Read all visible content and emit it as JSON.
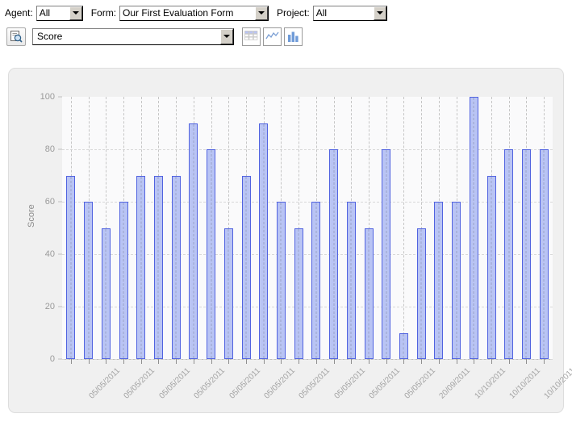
{
  "filters": {
    "agent": {
      "label": "Agent:",
      "value": "All",
      "icon": "chevron-down-icon"
    },
    "form": {
      "label": "Form:",
      "value": "Our First Evaluation Form",
      "icon": "chevron-down-icon"
    },
    "project": {
      "label": "Project:",
      "value": "All",
      "icon": "chevron-down-icon"
    }
  },
  "toolbar": {
    "preview_icon": "document-search-icon",
    "metric": {
      "value": "Score",
      "icon": "chevron-down-icon"
    },
    "view_buttons": [
      {
        "name": "table-view-button",
        "icon": "grid-table-icon",
        "active": false
      },
      {
        "name": "line-chart-view-button",
        "icon": "line-chart-icon",
        "active": false
      },
      {
        "name": "bar-chart-view-button",
        "icon": "bar-chart-icon",
        "active": true
      }
    ]
  },
  "chart_data": {
    "type": "bar",
    "title": "",
    "xlabel": "",
    "ylabel": "Score",
    "ylim": [
      0,
      100
    ],
    "yticks": [
      0,
      20,
      40,
      60,
      80,
      100
    ],
    "grid": true,
    "legend": false,
    "bar_color": "#b9c4f4",
    "bar_border_color": "#5163e0",
    "categories": [
      "05/05/2011",
      "05/05/2011",
      "05/05/2011",
      "05/05/2011",
      "05/05/2011",
      "05/05/2011",
      "05/05/2011",
      "05/05/2011",
      "05/05/2011",
      "05/05/2011",
      "05/05/2011",
      "05/05/2011",
      "05/05/2011",
      "05/05/2011",
      "05/05/2011",
      "05/05/2011",
      "05/05/2011",
      "05/05/2011",
      "05/05/2011",
      "05/05/2011",
      "20/09/2011",
      "20/09/2011",
      "10/10/2011",
      "10/10/2011",
      "10/10/2011",
      "10/10/2011",
      "10/10/2011",
      "10/10/2011"
    ],
    "values": [
      70,
      60,
      50,
      60,
      70,
      70,
      70,
      90,
      80,
      50,
      70,
      90,
      60,
      50,
      60,
      80,
      60,
      50,
      80,
      10,
      50,
      60,
      60,
      100,
      70,
      80,
      80,
      80
    ],
    "visible_tick_labels": [
      "05/05/2011",
      "05/05/2011",
      "05/05/2011",
      "05/05/2011",
      "05/05/2011",
      "05/05/2011",
      "05/05/2011",
      "05/05/2011",
      "05/05/2011",
      "05/05/2011",
      "05/05/2011",
      "20/09/2011",
      "10/10/2011",
      "10/10/2011",
      "10/10/2011",
      "10/10/2011"
    ]
  }
}
